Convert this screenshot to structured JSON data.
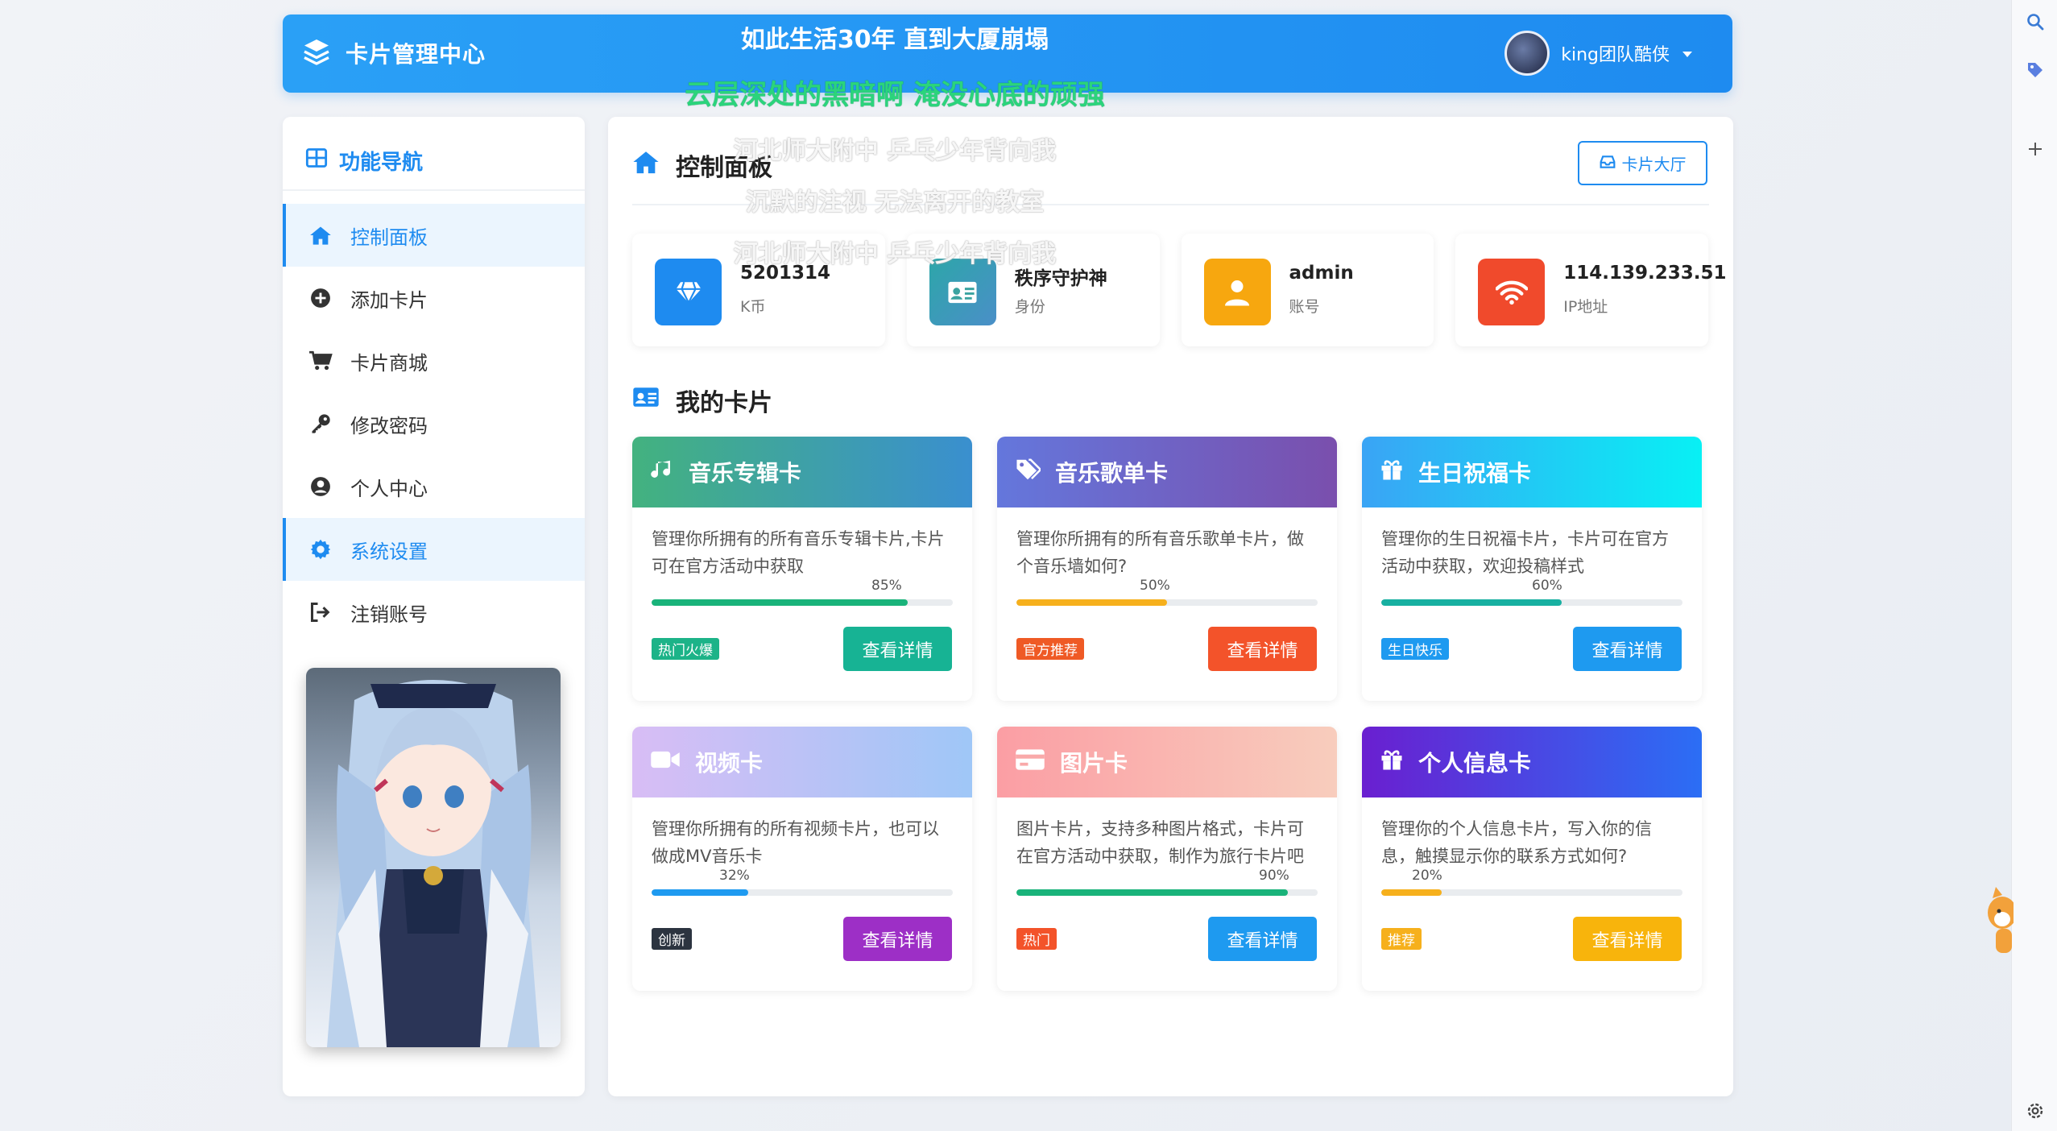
{
  "header": {
    "brand_title": "卡片管理中心",
    "user_name": "king团队酷侠"
  },
  "lyrics": [
    "如此生活30年 直到大厦崩塌",
    "云层深处的黑暗啊 淹没心底的顽强",
    "河北师大附中 乒乓少年背向我",
    "沉默的注视 无法离开的教室",
    "河北师大附中 乒乓少年背向我"
  ],
  "sidebar": {
    "title": "功能导航",
    "items": [
      {
        "label": "控制面板",
        "icon": "home-icon",
        "active": true
      },
      {
        "label": "添加卡片",
        "icon": "plus-circle-icon",
        "active": false
      },
      {
        "label": "卡片商城",
        "icon": "cart-icon",
        "active": false
      },
      {
        "label": "修改密码",
        "icon": "key-icon",
        "active": false
      },
      {
        "label": "个人中心",
        "icon": "user-circle-icon",
        "active": false
      },
      {
        "label": "系统设置",
        "icon": "gear-icon",
        "active": true
      },
      {
        "label": "注销账号",
        "icon": "logout-icon",
        "active": false
      }
    ]
  },
  "main": {
    "panel_title": "控制面板",
    "hall_button": "卡片大厅",
    "stats": [
      {
        "value": "5201314",
        "label": "K币",
        "icon": "diamond-icon",
        "color": "#1e8bf0"
      },
      {
        "value": "秩序守护神",
        "label": "身份",
        "icon": "id-card-icon",
        "color": "#3aa3a0"
      },
      {
        "value": "admin",
        "label": "账号",
        "icon": "user-icon",
        "color": "#f7a70f"
      },
      {
        "value": "114.139.233.51",
        "label": "IP地址",
        "icon": "wifi-icon",
        "color": "#f04a2c"
      }
    ],
    "section_title": "我的卡片",
    "cards": [
      {
        "title": "音乐专辑卡",
        "icon": "music-icon",
        "desc": "管理你所拥有的所有音乐专辑卡片,卡片可在官方活动中获取",
        "percent_label": "85%",
        "percent": 0.85,
        "bar_color": "#19b37a",
        "tag": "热门火爆",
        "tag_color": "#1cb388",
        "button": "查看详情",
        "button_color": "#17b394",
        "head_gradient": "linear-gradient(90deg,#43b27f,#3a8fcf)"
      },
      {
        "title": "音乐歌单卡",
        "icon": "tags-icon",
        "desc": "管理你所拥有的所有音乐歌单卡片，做个音乐墙如何?",
        "percent_label": "50%",
        "percent": 0.5,
        "bar_color": "#f6b01c",
        "tag": "官方推荐",
        "tag_color": "#ef5a25",
        "button": "查看详情",
        "button_color": "#f3532a",
        "head_gradient": "linear-gradient(90deg,#6477dc,#7a4fad)"
      },
      {
        "title": "生日祝福卡",
        "icon": "gift-icon",
        "desc": "管理你的生日祝福卡片，卡片可在官方活动中获取，欢迎投稿样式",
        "percent_label": "60%",
        "percent": 0.6,
        "bar_color": "#18b0a1",
        "tag": "生日快乐",
        "tag_color": "#1e9af0",
        "button": "查看详情",
        "button_color": "#1e9af0",
        "head_gradient": "linear-gradient(90deg,#3aa4f5,#08f0f4)"
      },
      {
        "title": "视频卡",
        "icon": "video-icon",
        "desc": "管理你所拥有的所有视频卡片，也可以做成MV音乐卡",
        "percent_label": "32%",
        "percent": 0.32,
        "bar_color": "#1e9af0",
        "tag": "创新",
        "tag_color": "#2c3440",
        "button": "查看详情",
        "button_color": "#9d2fc6",
        "head_gradient": "linear-gradient(90deg,#d8bdf5,#9fc7f7)"
      },
      {
        "title": "图片卡",
        "icon": "credit-card-icon",
        "desc": "图片卡片，支持多种图片格式，卡片可在官方活动中获取，制作为旅行卡片吧",
        "percent_label": "90%",
        "percent": 0.9,
        "bar_color": "#19b37a",
        "tag": "热门",
        "tag_color": "#f3532a",
        "button": "查看详情",
        "button_color": "#1e9af0",
        "head_gradient": "linear-gradient(90deg,#fb9ea4,#f8cdbd)"
      },
      {
        "title": "个人信息卡",
        "icon": "gift-icon",
        "desc": "管理你的个人信息卡片，写入你的信息，触摸显示你的联系方式如何?",
        "percent_label": "20%",
        "percent": 0.2,
        "bar_color": "#f6b01c",
        "tag": "推荐",
        "tag_color": "#f6b01c",
        "button": "查看详情",
        "button_color": "#f8b40c",
        "head_gradient": "linear-gradient(90deg,#6a1fd0,#2b6ef5)"
      }
    ]
  }
}
